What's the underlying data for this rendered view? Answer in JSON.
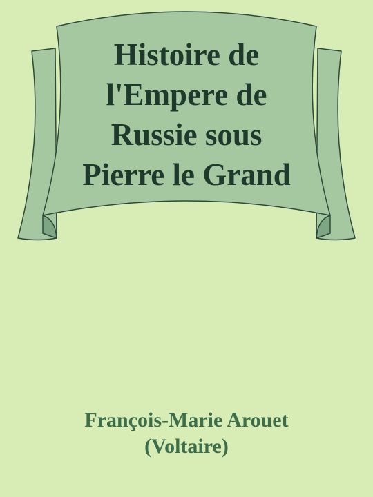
{
  "cover": {
    "title_lines": [
      "Histoire de",
      "l'Empere de",
      "Russie sous",
      "Pierre le Grand"
    ],
    "author_lines": [
      "François-Marie Arouet",
      "(Voltaire)"
    ]
  },
  "colors": {
    "background": "#d8edb6",
    "banner_fill": "#a5c8a1",
    "banner_shade": "#7fa684",
    "outline": "#2b4a3a",
    "title_text": "#1f3a2c",
    "author_text": "#3d6e4c"
  }
}
